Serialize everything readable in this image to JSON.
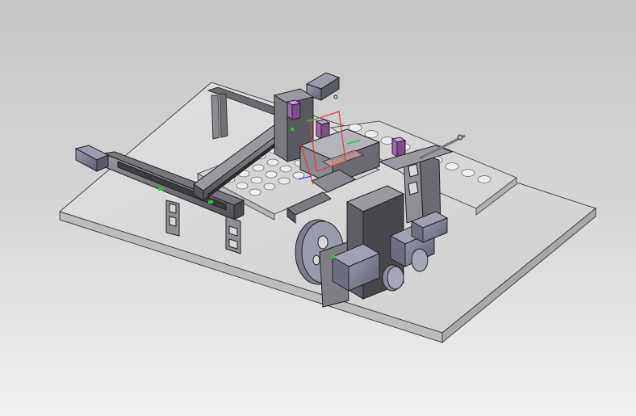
{
  "viewport": {
    "background_top": "#c6c6c6",
    "background_bottom": "#f0f0f0"
  },
  "model": {
    "plate_color": "#dcdcdc",
    "metal_dark": "#5a5a5e",
    "metal_mid": "#8c8c92",
    "metal_light": "#b4b4ba",
    "motor_color": "#7d7e8c",
    "cylinder_color": "#9b6aa8",
    "tray_color": "#d0d0d0",
    "accent_green": "#2fbf3f"
  },
  "triad": {
    "x_color": "#e23b3b",
    "y_color": "#2fbf3f",
    "z_color": "#3b4fe2"
  }
}
